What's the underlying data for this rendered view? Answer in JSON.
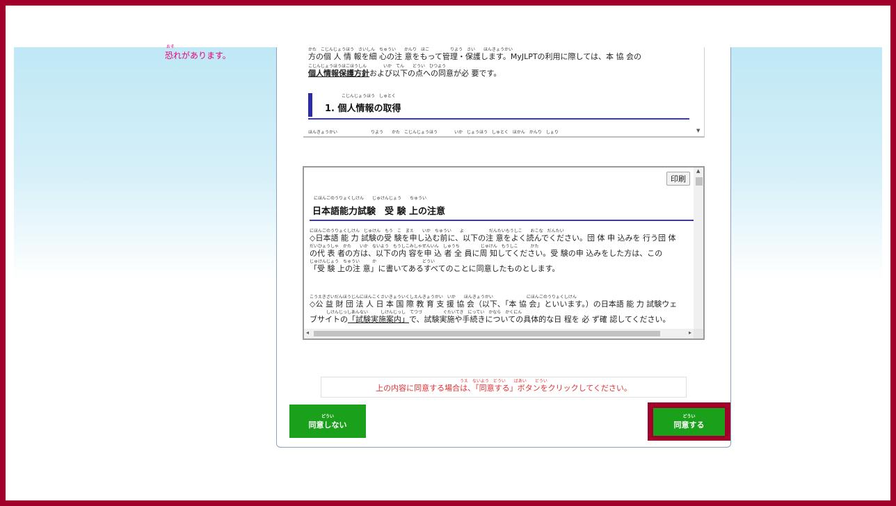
{
  "warning": {
    "ruby": "おそ",
    "text": "恐れがあります。"
  },
  "privacy_box": {
    "ruby_top": "かた　こじんじょうほう　さいしん　ちゅうい　　かんり　ほご　　　　　りよう　さい　　ほんきょうかい",
    "line1": "方の個 人 情 報を細 心の注 意をもって管理・保護します。MyJLPTの利用に際しては、本 協 会の",
    "ruby2": "こじんじょうほうほごほうしん　　　　いか　てん　　どうい　ひつよう",
    "line2_link": "個人情報保護方針",
    "line2_rest": "および以下の点への同意が必 要です。",
    "section_ruby": "こじんじょうほう　しゅとく",
    "section_title": "1. 個人情報の取得",
    "cut_ruby": "ほんきょうかい　　　　　　　　りよう　　かた　こじんじょうほう　　　　いか　じょうほう　しゅとく　ほかん　かんり　しょり"
  },
  "notice_box": {
    "print_button": "印刷",
    "title_ruby": "にほんごのうりょくしけん　　じゅけんじょう　　ちゅうい",
    "title": "日本語能力試験　受 験 上の注意",
    "p1_ruby1": "にほんごのうりょくしけん　じゅけん　もう　こ　まえ　　いか　ちゅうい　　よ　　　　　　だんたいもうしこ　　おこな　だんたい",
    "p1_line1": "◇日本語 能 力 試験の受 験を申し込む前に、以下の注 意をよく読んでください。団 体 申 込みを 行う団 体",
    "p1_ruby2": "だいひょうしゃ　かた　　いか　ないよう　もうしこみしゃぜんいん　しゅうち　　　　　じゅけん　もうしこ　　　かた",
    "p1_line2": "の代 表 者の方は、以下の内 容を申 込 者 全 員に周 知してください。受 験の申 込みをした方は、この",
    "p1_ruby3": "じゅけんじょう　ちゅうい　　　か　　　　　　　　　　　どうい",
    "p1_line3": "「受 験 上の注 意」に書いてあるすべてのことに同意したものとします。",
    "p2_ruby1": "こうえきざいだんほうじんにほんこくさいきょういくしえんきょうかい　いか　　ほんきょうかい　　　　　　　　にほんごのうりょくしけん",
    "p2_line1": "◇公 益 財 団 法 人 日 本 国 際 教 育 支 援 協 会（以下、「本 協 会」といいます。）の日本語 能 力 試験ウェ",
    "p2_ruby2": "　　　　しけんじっしあんない　　　しけんじっし　てつづ　　　　　ぐたいてき　にってい　かなら　かくにん",
    "p2_line2_pre": "ブサイトの",
    "p2_line2_link": "「試験実施案内」",
    "p2_line2_post": "で、試験実施や手続きについての具体的な日 程を 必 ず確 認してください。"
  },
  "instruction": {
    "ruby": "うえ　ないよう　どうい　　ばあい　　どうい",
    "text": "上の内容に同意する場合は、「同意する」ボタンをクリックしてください。"
  },
  "buttons": {
    "disagree_ruby": "どうい",
    "disagree": "同意しない",
    "agree_ruby": "どうい",
    "agree": "同意する"
  },
  "colors": {
    "frame": "#a0002a",
    "button": "#1aa01a",
    "accent": "#e6007e",
    "heading_rule": "#3c3ca8"
  }
}
